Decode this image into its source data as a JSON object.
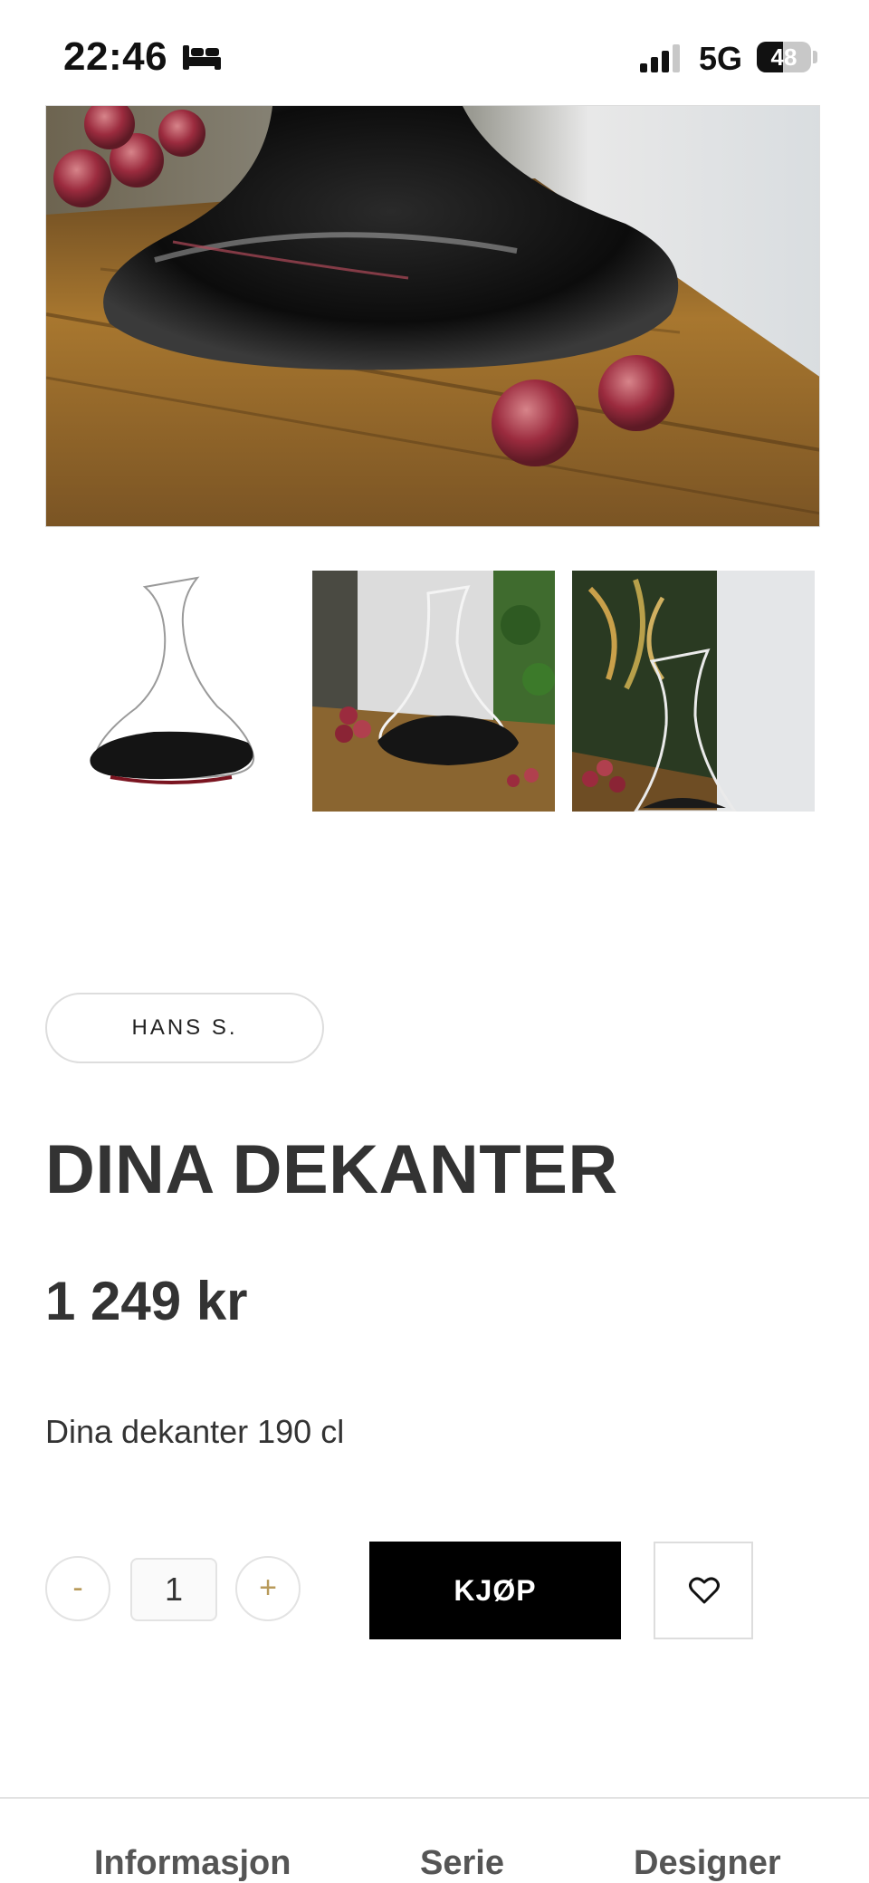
{
  "status_bar": {
    "time": "22:46",
    "network": "5G",
    "battery_level": "48",
    "battery_fraction": 0.48,
    "icons": [
      "bed-icon",
      "signal-icon",
      "battery-icon"
    ]
  },
  "gallery": {
    "hero_image": "decanter-on-wooden-table-with-grapes",
    "thumbnails": [
      {
        "image": "decanter-white-background"
      },
      {
        "image": "decanter-on-table-with-grapes"
      },
      {
        "image": "decanter-with-plants"
      }
    ]
  },
  "product": {
    "brand": "HANS S.",
    "title": "DINA DEKANTER",
    "price": "1 249 kr",
    "description": "Dina dekanter 190 cl"
  },
  "purchase": {
    "minus_label": "-",
    "quantity": "1",
    "plus_label": "+",
    "buy_label": "KJØP",
    "wishlist_icon": "heart-icon"
  },
  "tabs": [
    {
      "label": "Informasjon"
    },
    {
      "label": "Serie"
    },
    {
      "label": "Designer"
    }
  ],
  "colors": {
    "accent": "#b89a5a",
    "buy_button": "#000000",
    "text": "#333333"
  }
}
